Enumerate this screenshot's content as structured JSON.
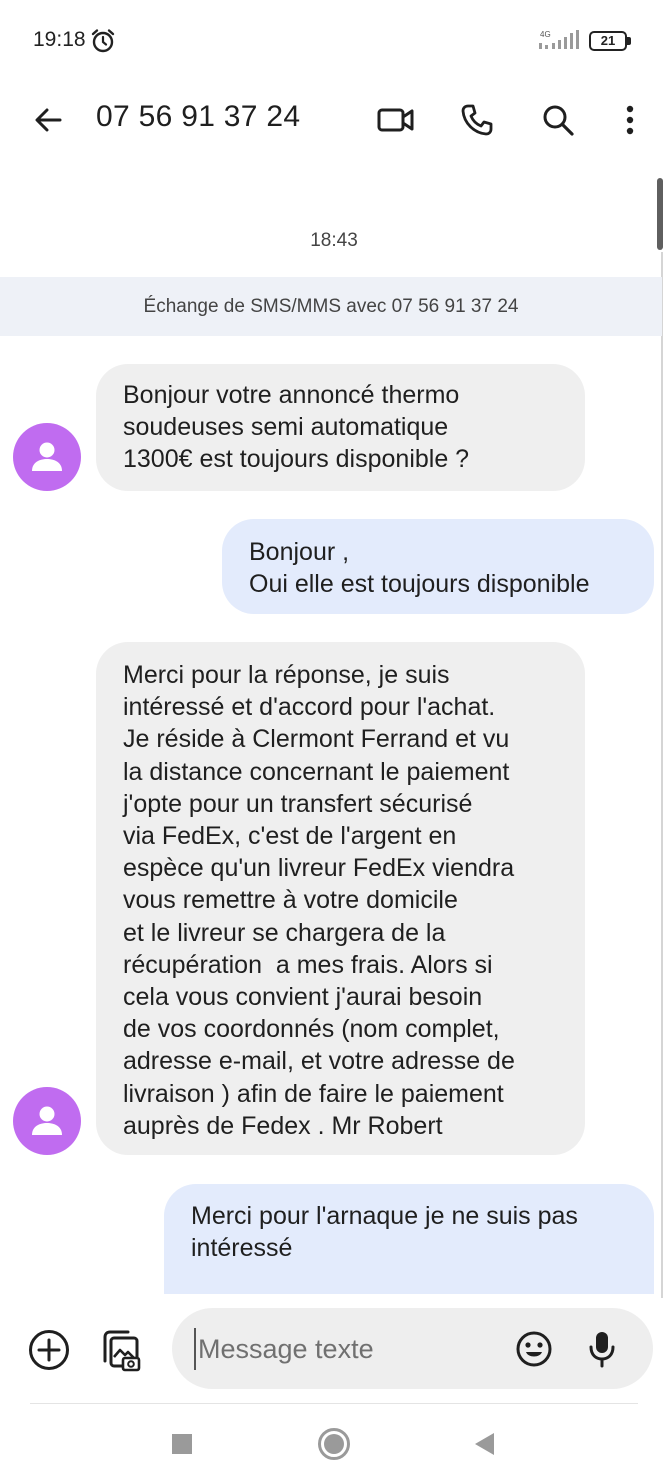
{
  "status_bar": {
    "time": "19:18",
    "network": "4G",
    "battery": "21",
    "icons": [
      "alarm-icon",
      "signal-icon",
      "battery-icon"
    ]
  },
  "app_bar": {
    "title": "07 56 91 37 24",
    "icons": [
      "back-arrow-icon",
      "video-call-icon",
      "phone-icon",
      "search-icon",
      "more-vert-icon"
    ]
  },
  "conversation": {
    "timestamp": "18:43",
    "banner": "Échange de SMS/MMS avec 07 56 91 37 24",
    "messages": [
      {
        "direction": "incoming",
        "text": "Bonjour votre annoncé thermo\nsoudeuses semi automatique\n1300€ est toujours disponible ?"
      },
      {
        "direction": "outgoing",
        "text": "Bonjour ,\nOui elle est toujours disponible"
      },
      {
        "direction": "incoming",
        "text": "Merci pour la réponse, je suis\nintéressé et d'accord pour l'achat.\nJe réside à Clermont Ferrand et vu\nla distance concernant le paiement\nj'opte pour un transfert sécurisé\nvia FedEx, c'est de l'argent en\nespèce qu'un livreur FedEx viendra\nvous remettre à votre domicile\net le livreur se chargera de la\nrécupération  a mes frais. Alors si\ncela vous convient j'aurai besoin\nde vos coordonnés (nom complet,\nadresse e-mail, et votre adresse de\nlivraison ) afin de faire le paiement\nauprès de Fedex . Mr Robert"
      },
      {
        "direction": "outgoing",
        "text": "Merci pour l'arnaque je ne suis pas\nintéressé"
      }
    ]
  },
  "compose": {
    "placeholder": "Message texte",
    "value": "",
    "icons": [
      "add-circle-icon",
      "gallery-icon",
      "emoji-icon",
      "mic-icon"
    ]
  },
  "nav_bar": {
    "icons": [
      "recents-square-icon",
      "home-circle-icon",
      "back-triangle-icon"
    ]
  },
  "colors": {
    "incoming_bubble": "#efefef",
    "outgoing_bubble": "#e3ebfc",
    "avatar": "#c06cf0",
    "banner": "#eef1f7"
  }
}
